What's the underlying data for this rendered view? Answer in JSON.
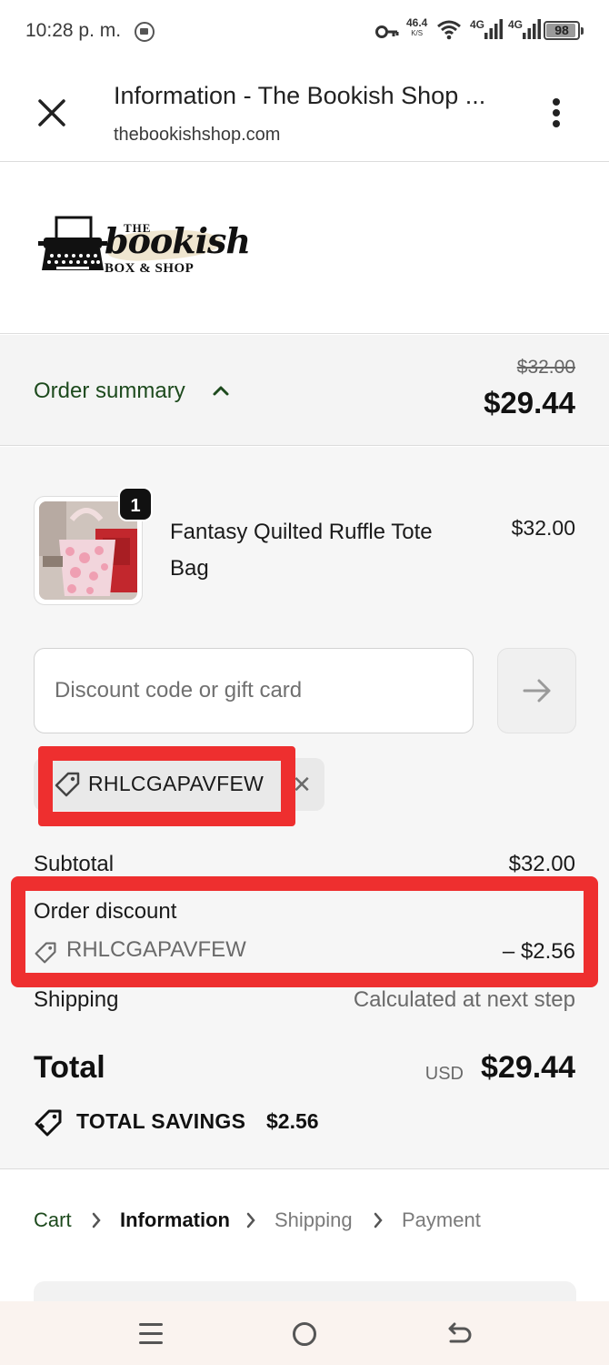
{
  "status_bar": {
    "time": "10:28 p. m.",
    "net_speed_value": "46.4",
    "net_speed_unit": "K/S",
    "network_1": "4G",
    "network_2": "4G",
    "battery": "98"
  },
  "browser": {
    "title": "Information - The Bookish Shop ...",
    "url": "thebookishshop.com"
  },
  "logo": {
    "the": "THE",
    "name": "bookish",
    "sub": "BOX & SHOP"
  },
  "summary": {
    "toggle_label": "Order summary",
    "original_total": "$32.00",
    "total": "$29.44"
  },
  "product": {
    "quantity": "1",
    "name": "Fantasy Quilted Ruffle Tote Bag",
    "price": "$32.00"
  },
  "discount": {
    "placeholder": "Discount code or gift card",
    "applied_code": "RHLCGAPAVFEW"
  },
  "totals": {
    "subtotal_label": "Subtotal",
    "subtotal_value": "$32.00",
    "order_discount_label": "Order discount",
    "order_discount_code": "RHLCGAPAVFEW",
    "order_discount_value": "– $2.56",
    "shipping_label": "Shipping",
    "shipping_value": "Calculated at next step",
    "total_label": "Total",
    "total_currency": "USD",
    "total_value": "$29.44",
    "savings_label": "TOTAL SAVINGS",
    "savings_value": "$2.56"
  },
  "breadcrumb": {
    "cart": "Cart",
    "information": "Information",
    "shipping": "Shipping",
    "payment": "Payment"
  },
  "colors": {
    "link_green": "#1d4a1d",
    "highlight_red": "#ee2f2f"
  }
}
